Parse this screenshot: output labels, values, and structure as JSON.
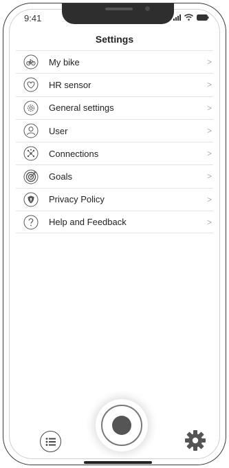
{
  "status_bar": {
    "time": "9:41"
  },
  "header": {
    "title": "Settings"
  },
  "settings": {
    "items": [
      {
        "label": "My bike",
        "icon": "bike-icon"
      },
      {
        "label": "HR sensor",
        "icon": "heart-icon"
      },
      {
        "label": "General settings",
        "icon": "cog-icon"
      },
      {
        "label": "User",
        "icon": "user-icon"
      },
      {
        "label": "Connections",
        "icon": "connections-icon"
      },
      {
        "label": "Goals",
        "icon": "target-icon"
      },
      {
        "label": "Privacy Policy",
        "icon": "shield-icon"
      },
      {
        "label": "Help and Feedback",
        "icon": "question-icon"
      }
    ],
    "chevron": ">"
  },
  "bottom_bar": {
    "left_icon": "list-icon",
    "center_icon": "record-icon",
    "right_icon": "gear-icon"
  }
}
